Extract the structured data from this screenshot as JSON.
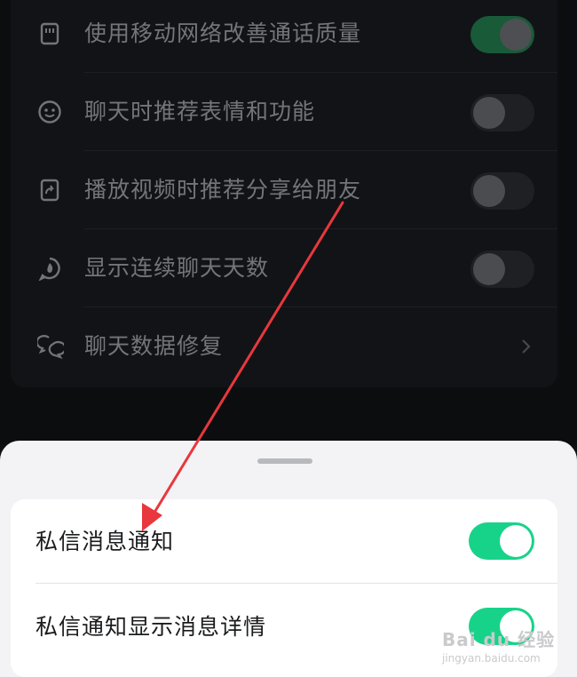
{
  "settings": {
    "rows": [
      {
        "label": "使用移动网络改善通话质量",
        "icon": "sim-card-icon",
        "control": "toggle",
        "on": true
      },
      {
        "label": "聊天时推荐表情和功能",
        "icon": "smiley-icon",
        "control": "toggle",
        "on": false
      },
      {
        "label": "播放视频时推荐分享给朋友",
        "icon": "share-video-icon",
        "control": "toggle",
        "on": false
      },
      {
        "label": "显示连续聊天天数",
        "icon": "flame-chat-icon",
        "control": "toggle",
        "on": false
      },
      {
        "label": "聊天数据修复",
        "icon": "chat-repair-icon",
        "control": "chevron"
      }
    ]
  },
  "sheet": {
    "rows": [
      {
        "label": "私信消息通知",
        "on": true
      },
      {
        "label": "私信通知显示消息详情",
        "on": true
      }
    ]
  },
  "watermark": {
    "main": "Bai du 经验",
    "sub": "jingyan.baidu.com"
  },
  "colors": {
    "toggle_on_sheet": "#17d389",
    "toggle_on_dim": "#1f6e45",
    "annotation_arrow": "#e8383d"
  }
}
